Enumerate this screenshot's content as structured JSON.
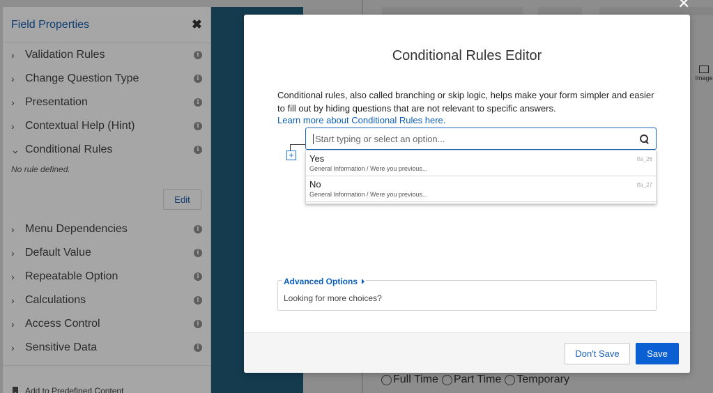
{
  "field_properties": {
    "title": "Field Properties",
    "close_glyph": "✖",
    "items_top": [
      {
        "label": "Validation Rules",
        "expanded": false
      },
      {
        "label": "Change Question Type",
        "expanded": false
      },
      {
        "label": "Presentation",
        "expanded": false
      },
      {
        "label": "Contextual Help (Hint)",
        "expanded": false
      },
      {
        "label": "Conditional Rules",
        "expanded": true
      }
    ],
    "no_rule_text": "No rule defined.",
    "edit_label": "Edit",
    "items_bottom": [
      {
        "label": "Menu Dependencies"
      },
      {
        "label": "Default Value"
      },
      {
        "label": "Repeatable Option"
      },
      {
        "label": "Calculations"
      },
      {
        "label": "Access Control"
      },
      {
        "label": "Sensitive Data"
      }
    ],
    "info_glyph": "i",
    "footer_label": "Add to Predefined Content"
  },
  "background_form": {
    "radio_options": [
      "Full Time",
      "Part Time",
      "Temporary"
    ],
    "image_tool_label": "Image"
  },
  "modal": {
    "title": "Conditional Rules Editor",
    "description": "Conditional rules, also called branching or skip logic, helps make your form simpler and easier to fill out by hiding questions that are not relevant to specific answers.",
    "learn_link": "Learn more about Conditional Rules here.",
    "search_placeholder": "Start typing or select an option...",
    "options": [
      {
        "label": "Yes",
        "path": "General Information / Were you previous...",
        "id": "tfa_26"
      },
      {
        "label": "No",
        "path": "General Information / Were you previous...",
        "id": "tfa_27"
      }
    ],
    "advanced_label": "Advanced Options",
    "advanced_text": "Looking for more choices?",
    "dont_save_label": "Don't Save",
    "save_label": "Save",
    "add_glyph": "+"
  },
  "colors": {
    "accent": "#0a5fd2",
    "link": "#0b5fb8",
    "panel_title": "#0d3a70",
    "dark_column": "#153b4f"
  },
  "icons": [
    "close-icon",
    "chevron-right-icon",
    "chevron-down-icon",
    "info-icon",
    "bookmark-icon",
    "search-icon",
    "add-rule-icon",
    "caret-right-icon",
    "image-icon",
    "modal-close-icon"
  ]
}
